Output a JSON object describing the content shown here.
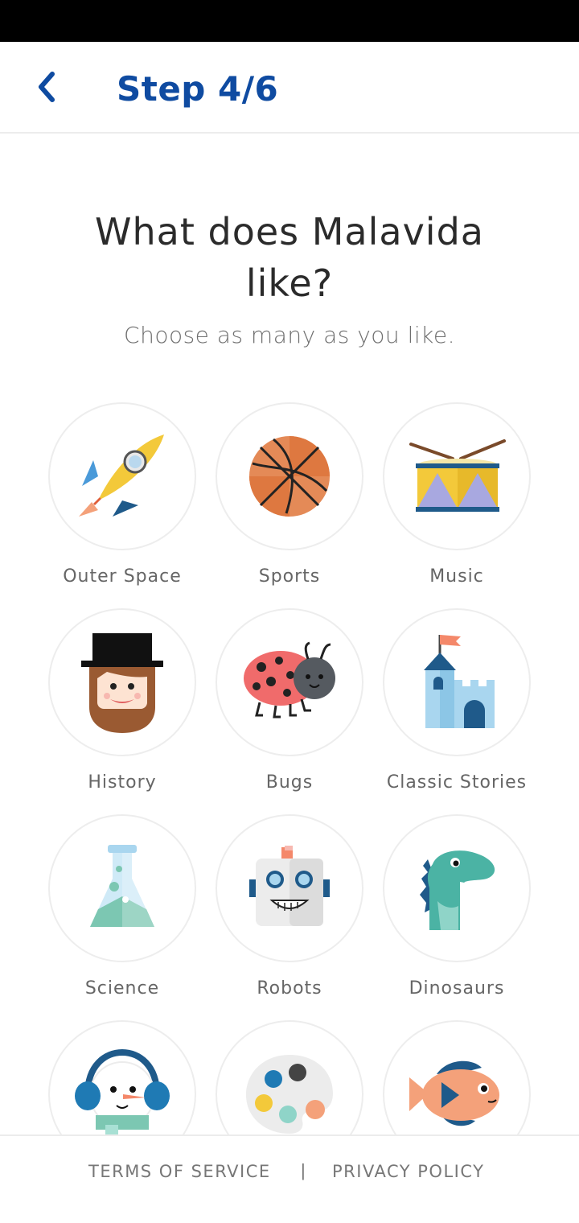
{
  "header": {
    "back_icon": "chevron-left-icon",
    "step_title": "Step 4/6"
  },
  "question": {
    "title": "What does Malavida like?",
    "subtitle": "Choose as many as you like."
  },
  "interests": [
    {
      "label": "Outer Space",
      "icon": "rocket-icon"
    },
    {
      "label": "Sports",
      "icon": "basketball-icon"
    },
    {
      "label": "Music",
      "icon": "drum-icon"
    },
    {
      "label": "History",
      "icon": "bearded-man-top-hat-icon"
    },
    {
      "label": "Bugs",
      "icon": "ladybug-icon"
    },
    {
      "label": "Classic Stories",
      "icon": "castle-icon"
    },
    {
      "label": "Science",
      "icon": "flask-icon"
    },
    {
      "label": "Robots",
      "icon": "robot-icon"
    },
    {
      "label": "Dinosaurs",
      "icon": "dinosaur-icon"
    },
    {
      "label": "",
      "icon": "snowman-headphones-icon"
    },
    {
      "label": "",
      "icon": "paint-palette-icon"
    },
    {
      "label": "",
      "icon": "fish-icon"
    }
  ],
  "footer": {
    "terms": "TERMS OF SERVICE",
    "separator": "|",
    "privacy": "PRIVACY POLICY"
  },
  "colors": {
    "brand_blue": "#0f4ba1",
    "status_bar": "#000000"
  }
}
